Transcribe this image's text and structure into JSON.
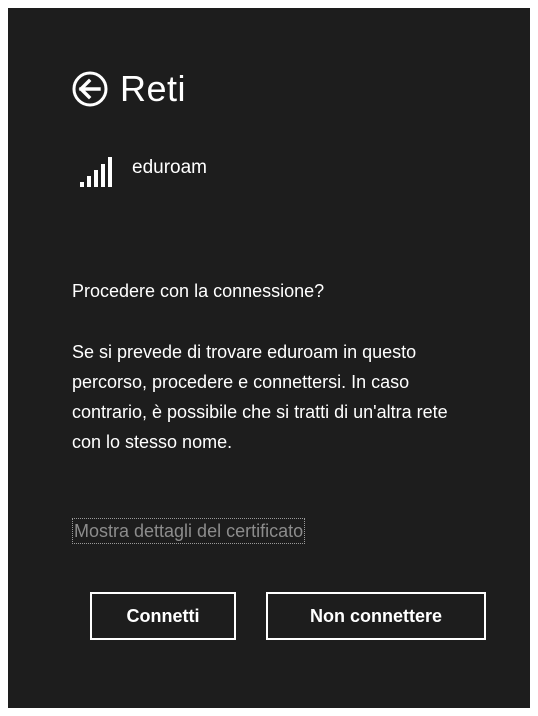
{
  "header": {
    "title": "Reti",
    "back_icon": "back-arrow-circle-icon"
  },
  "network": {
    "ssid": "eduroam",
    "signal_icon": "wifi-signal-bars-icon",
    "signal_bars": 5
  },
  "prompt": {
    "question": "Procedere con la connessione?",
    "description": "Se si prevede di trovare eduroam in questo percorso, procedere e connettersi. In caso contrario, è possibile che si tratti di un'altra rete con lo stesso nome.",
    "cert_link": "Mostra dettagli del certificato"
  },
  "buttons": {
    "connect": "Connetti",
    "dont_connect": "Non connettere"
  },
  "colors": {
    "background": "#1d1d1d",
    "foreground": "#ffffff",
    "link_muted": "#8c8c8c"
  }
}
